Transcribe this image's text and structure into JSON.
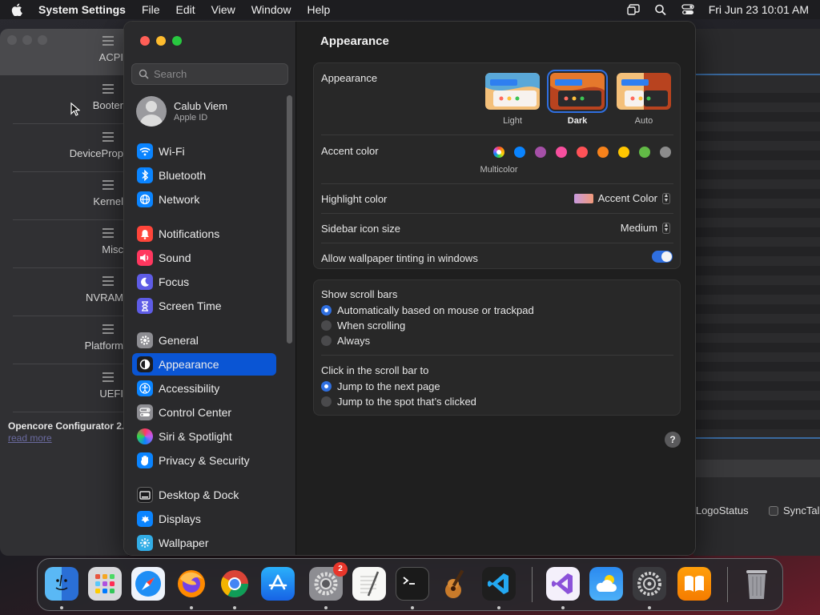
{
  "menubar": {
    "app_name": "System Settings",
    "items": [
      "File",
      "Edit",
      "View",
      "Window",
      "Help"
    ],
    "clock": "Fri Jun 23  10:01 AM"
  },
  "background_window": {
    "sidebar_items": [
      "ACPI",
      "Booter",
      "DeviceProp",
      "Kernel",
      "Misc",
      "NVRAM",
      "Platform",
      "UEFI"
    ],
    "footer_title": "Opencore Configurator 2.",
    "footer_link": "read more",
    "right_labels": [
      "etLogoStatus",
      "SyncTal"
    ]
  },
  "sidebar": {
    "search_placeholder": "Search",
    "profile": {
      "name": "Calub Viem",
      "subtitle": "Apple ID"
    },
    "items": [
      {
        "label": "Wi-Fi",
        "icon": "wifi-icon",
        "color": "#0a84ff"
      },
      {
        "label": "Bluetooth",
        "icon": "bluetooth-icon",
        "color": "#0a84ff"
      },
      {
        "label": "Network",
        "icon": "globe-icon",
        "color": "#0a84ff"
      },
      {
        "label": "Notifications",
        "icon": "bell-icon",
        "color": "#ff453a"
      },
      {
        "label": "Sound",
        "icon": "speaker-icon",
        "color": "#ff375f"
      },
      {
        "label": "Focus",
        "icon": "moon-icon",
        "color": "#5e5ce6"
      },
      {
        "label": "Screen Time",
        "icon": "hourglass-icon",
        "color": "#5e5ce6"
      },
      {
        "label": "General",
        "icon": "gear-icon",
        "color": "#8e8e93"
      },
      {
        "label": "Appearance",
        "icon": "appearance-icon",
        "color": "#1c1c1e"
      },
      {
        "label": "Accessibility",
        "icon": "accessibility-icon",
        "color": "#0a84ff"
      },
      {
        "label": "Control Center",
        "icon": "control-center-icon",
        "color": "#8e8e93"
      },
      {
        "label": "Siri & Spotlight",
        "icon": "siri-icon",
        "color": "#bf5af2"
      },
      {
        "label": "Privacy & Security",
        "icon": "hand-icon",
        "color": "#0a84ff"
      },
      {
        "label": "Desktop & Dock",
        "icon": "desktop-icon",
        "color": "#1c1c1e"
      },
      {
        "label": "Displays",
        "icon": "display-icon",
        "color": "#0a84ff"
      },
      {
        "label": "Wallpaper",
        "icon": "wallpaper-icon",
        "color": "#32ade6"
      }
    ],
    "selected": "Appearance"
  },
  "content": {
    "title": "Appearance",
    "appearance": {
      "label": "Appearance",
      "options": [
        "Light",
        "Dark",
        "Auto"
      ],
      "selected": "Dark"
    },
    "accent": {
      "label": "Accent color",
      "caption": "Multicolor",
      "colors": [
        "#0a84ff",
        "#a550a7",
        "#f74f9e",
        "#ff5257",
        "#f7821b",
        "#ffc600",
        "#62ba46",
        "#8c8c8c"
      ]
    },
    "highlight": {
      "label": "Highlight color",
      "value": "Accent Color"
    },
    "sidebar_icon_size": {
      "label": "Sidebar icon size",
      "value": "Medium"
    },
    "wallpaper_tinting": {
      "label": "Allow wallpaper tinting in windows",
      "on": true
    },
    "scroll_bars": {
      "label": "Show scroll bars",
      "options": [
        "Automatically based on mouse or trackpad",
        "When scrolling",
        "Always"
      ],
      "selected": 0
    },
    "click_scroll": {
      "label": "Click in the scroll bar to",
      "options": [
        "Jump to the next page",
        "Jump to the spot that’s clicked"
      ],
      "selected": 0
    },
    "help": "?"
  },
  "dock": {
    "apps": [
      "finder-icon",
      "launchpad-icon",
      "safari-icon",
      "firefox-icon",
      "chrome-icon",
      "app-store-icon",
      "system-settings-icon",
      "textedit-icon",
      "terminal-icon",
      "garageband-icon",
      "vscode-icon",
      "visual-studio-icon",
      "weather-icon",
      "opencore-icon",
      "books-icon",
      "trash-icon"
    ],
    "settings_badge": "2"
  }
}
